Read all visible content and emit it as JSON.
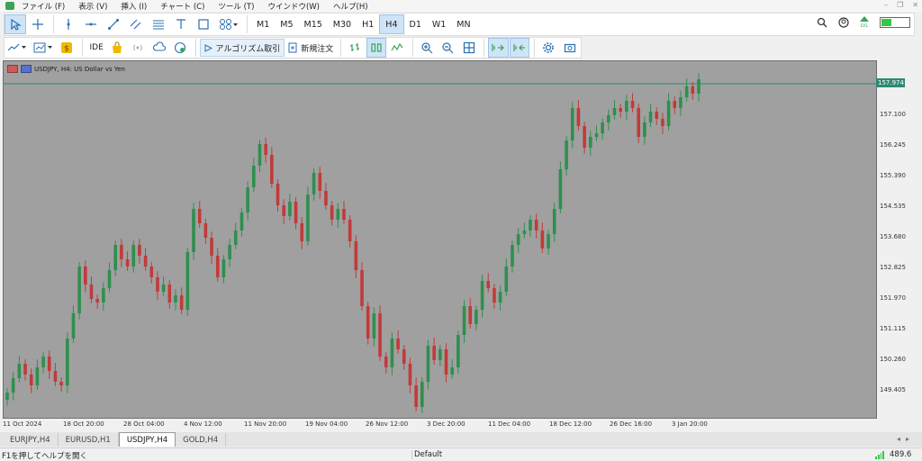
{
  "menu": {
    "items": [
      "ファイル (F)",
      "表示 (V)",
      "挿入 (I)",
      "チャート (C)",
      "ツール (T)",
      "ウインドウ(W)",
      "ヘルプ(H)"
    ]
  },
  "toolbar1": {
    "tools": [
      "cursor-icon",
      "crosshair-icon",
      "vertical-line-icon",
      "horizontal-line-icon",
      "trendline-icon",
      "channel-icon",
      "fibonacci-icon",
      "text-icon",
      "shapes-icon",
      "objects-icon"
    ],
    "timeframes": [
      "M1",
      "M5",
      "M15",
      "M30",
      "H1",
      "H4",
      "D1",
      "W1",
      "MN"
    ],
    "selected_timeframe": "H4",
    "right_icons": [
      "search-icon",
      "account-icon",
      "level-icon"
    ],
    "level_label": "LVL",
    "battery_fill": 0.35
  },
  "toolbar2": {
    "algo_label": "アルゴリズム取引",
    "new_order_label": "新規注文",
    "ide_label": "IDE"
  },
  "chart": {
    "title": "USDJPY, H4:  US Dollar vs Yen",
    "current_price": "157.974",
    "y_labels": [
      "157.100",
      "156.245",
      "155.390",
      "154.535",
      "153.680",
      "152.825",
      "151.970",
      "151.115",
      "150.260",
      "149.405"
    ],
    "x_labels": [
      "11 Oct 2024",
      "18 Oct 20:00",
      "28 Oct 04:00",
      "4 Nov 12:00",
      "11 Nov 20:00",
      "19 Nov 04:00",
      "26 Nov 12:00",
      "3 Dec 20:00",
      "11 Dec 04:00",
      "18 Dec 12:00",
      "26 Dec 16:00",
      "3 Jan 20:00"
    ],
    "colors": {
      "bull": "#2f8f4e",
      "bear": "#c23a3a",
      "background": "#a0a0a0",
      "price_line": "#2d8a75"
    }
  },
  "chart_data": {
    "type": "candlestick",
    "symbol": "USDJPY",
    "timeframe": "H4",
    "ylim": [
      148.7,
      158.6
    ],
    "grid": false,
    "closes": [
      149.4,
      149.8,
      150.2,
      149.9,
      149.6,
      150.1,
      150.4,
      150.0,
      149.7,
      149.6,
      150.9,
      151.6,
      152.9,
      152.4,
      152.0,
      151.9,
      152.3,
      152.8,
      153.5,
      153.1,
      152.9,
      153.5,
      153.2,
      152.9,
      152.6,
      152.2,
      152.4,
      151.9,
      152.1,
      151.7,
      153.3,
      154.5,
      154.1,
      153.7,
      153.2,
      152.6,
      153.1,
      153.5,
      153.9,
      154.4,
      155.1,
      155.7,
      156.3,
      156.0,
      155.2,
      154.6,
      154.3,
      154.7,
      154.1,
      153.6,
      154.9,
      155.5,
      155.0,
      154.6,
      154.2,
      154.5,
      154.2,
      153.6,
      152.8,
      151.8,
      150.9,
      151.6,
      150.4,
      150.1,
      150.9,
      150.6,
      150.2,
      149.6,
      149.0,
      149.7,
      150.7,
      150.3,
      150.6,
      149.9,
      150.1,
      151.0,
      151.8,
      151.3,
      151.7,
      152.5,
      152.3,
      151.9,
      152.2,
      152.9,
      153.5,
      153.8,
      153.9,
      154.2,
      153.9,
      153.4,
      153.8,
      154.5,
      155.6,
      156.4,
      157.3,
      156.8,
      156.2,
      156.5,
      156.6,
      156.9,
      157.1,
      157.3,
      157.2,
      157.5,
      157.3,
      156.5,
      156.9,
      157.2,
      157.0,
      156.8,
      157.5,
      157.3,
      157.6,
      157.9,
      157.7,
      158.1
    ]
  },
  "tabs": {
    "items": [
      "EURJPY,H4",
      "EURUSD,H1",
      "USDJPY,H4",
      "GOLD,H4"
    ],
    "active": "USDJPY,H4"
  },
  "status": {
    "help_text": "F1を押してヘルプを開く",
    "profile": "Default",
    "ping": "489.6"
  }
}
